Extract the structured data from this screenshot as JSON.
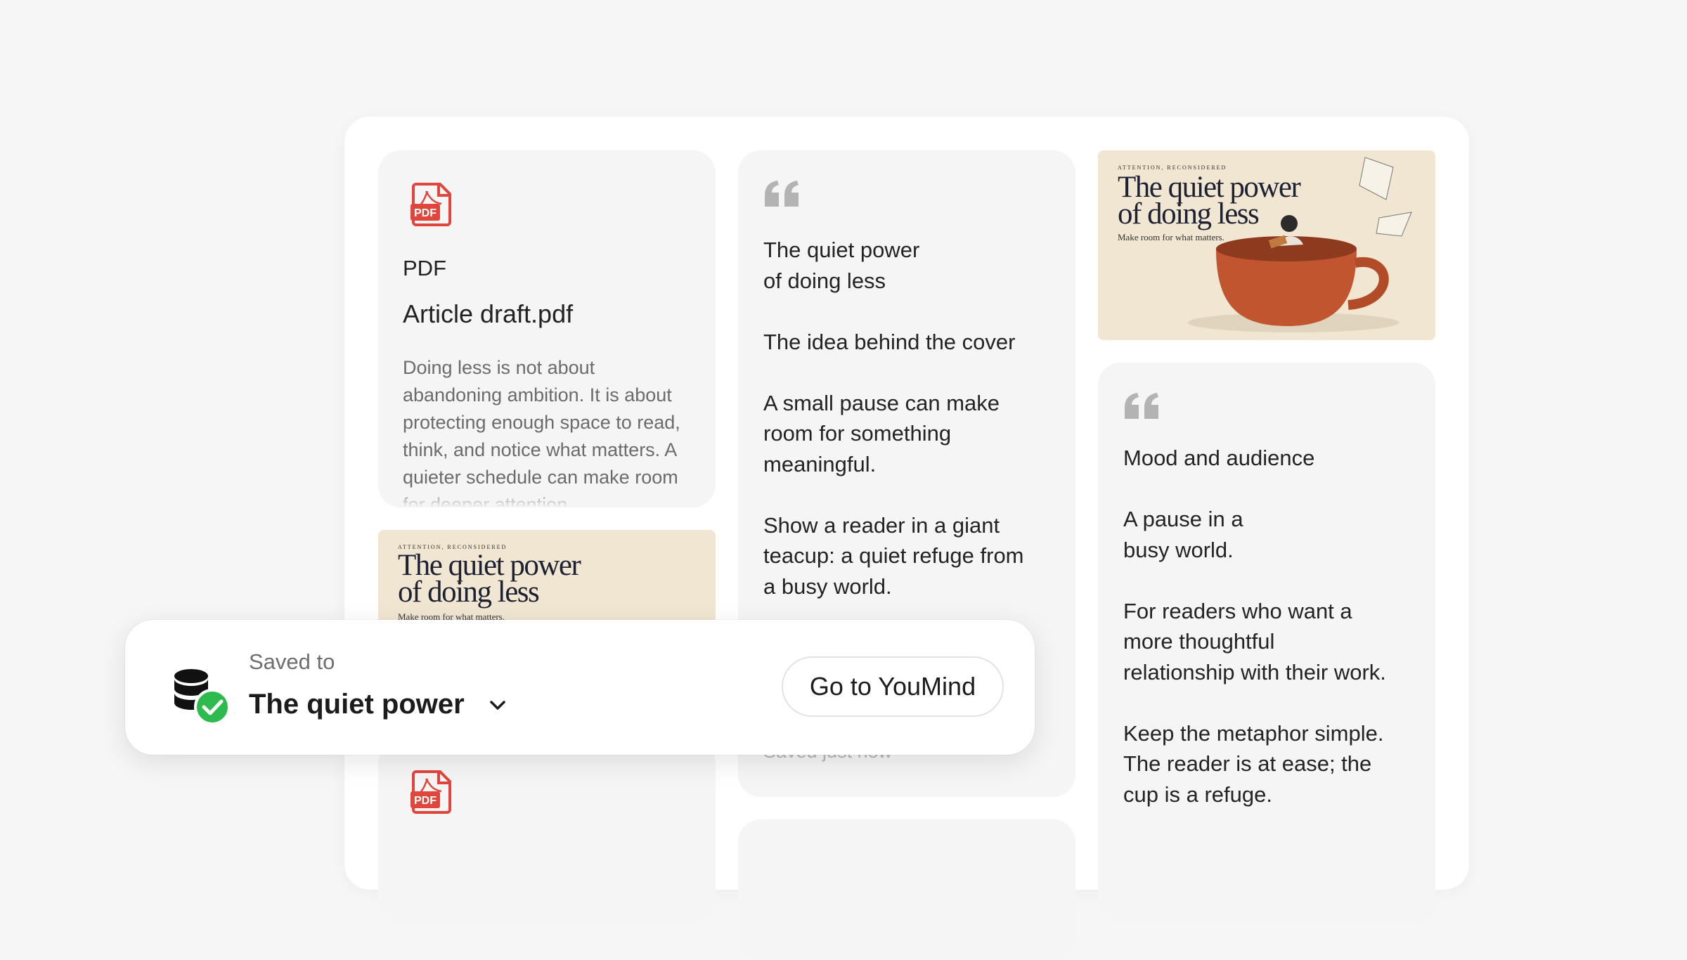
{
  "pdf_card_1": {
    "type_label": "PDF",
    "title": "Article draft.pdf",
    "description": "Doing less is not about abandoning ambition. It is about protecting enough space to read, think, and notice what matters. A quieter schedule can make room for deeper attention."
  },
  "note_card_1": {
    "text": "The quiet power\nof doing less\n\nThe idea behind the cover\n\nA small pause can make\nroom for something\nmeaningful.\n\nShow a reader in a giant\nteacup: a quiet refuge from\na busy world.",
    "saved_status": "Saved just now"
  },
  "cover": {
    "kicker": "ATTENTION, RECONSIDERED",
    "title": "The quiet power\nof doing less",
    "subtitle": "Make room for what matters."
  },
  "note_card_2": {
    "text": "Mood and audience\n\nA pause in a\nbusy world.\n\nFor readers who want a\nmore thoughtful\nrelationship with their work.\n\nKeep the metaphor simple.\nThe reader is at ease; the\ncup is a refuge."
  },
  "toast": {
    "label": "Saved to",
    "collection": "The quiet power",
    "button": "Go to YouMind"
  },
  "icons": {
    "pdf": "pdf-file-icon",
    "quote": "quote-icon",
    "saved": "database-check-icon",
    "chevron": "chevron-down-icon"
  },
  "colors": {
    "pdf_red": "#e0463c",
    "check_green": "#2dbb4e",
    "quote_gray": "#b3b3b3"
  }
}
